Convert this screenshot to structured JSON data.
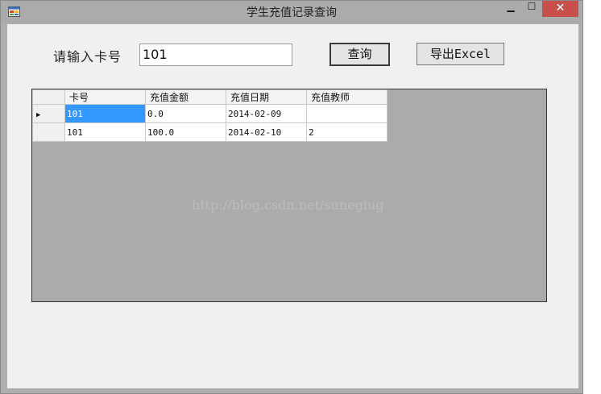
{
  "window": {
    "title": "学生充值记录查询",
    "minimize_glyph": "▁",
    "maximize_glyph": "☐",
    "close_glyph": "✕"
  },
  "form": {
    "card_label": "请输入卡号",
    "card_value": "101",
    "query_button": "查询",
    "export_button": "导出Excel"
  },
  "grid": {
    "columns": [
      "卡号",
      "充值金额",
      "充值日期",
      "充值教师"
    ],
    "current_row_glyph": "▶",
    "rows": [
      [
        "101",
        "0.0",
        "2014-02-09",
        ""
      ],
      [
        "101",
        "100.0",
        "2014-02-10",
        "2"
      ]
    ],
    "watermark": "http://blog.csdn.net/sunegiug"
  }
}
